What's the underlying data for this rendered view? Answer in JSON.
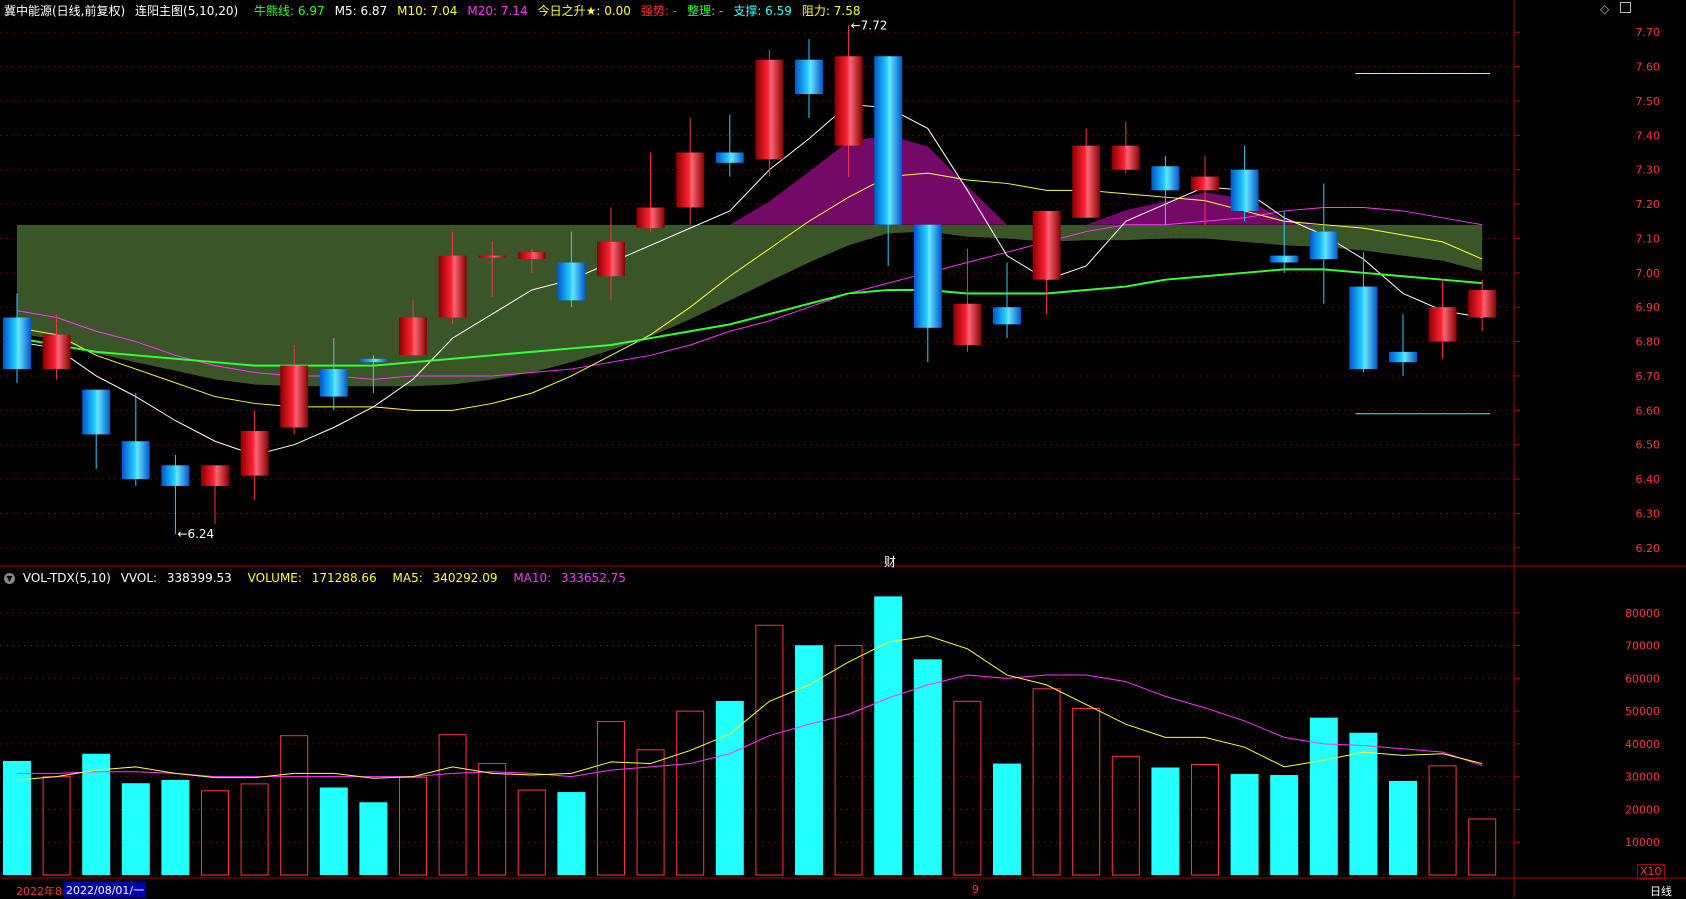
{
  "main_header": {
    "security": "冀中能源(日线,前复权)",
    "indicator": "连阳主图(5,10,20)",
    "items": [
      {
        "label": "牛熊线:",
        "value": "6.97",
        "color": "#33ff33"
      },
      {
        "label": "M5:",
        "value": "6.87",
        "color": "#ffffff"
      },
      {
        "label": "M10:",
        "value": "7.04",
        "color": "#ffff33"
      },
      {
        "label": "M20:",
        "value": "7.14",
        "color": "#ff33ff"
      },
      {
        "label": "今日之升★:",
        "value": "0.00",
        "color": "#ffff33"
      },
      {
        "label": "强势:",
        "value": "-",
        "color": "#ff3333"
      },
      {
        "label": "整理:",
        "value": "-",
        "color": "#33ff33"
      },
      {
        "label": "支撑:",
        "value": "6.59",
        "color": "#33ffff"
      },
      {
        "label": "阻力:",
        "value": "7.58",
        "color": "#ffff33"
      }
    ]
  },
  "vol_header": {
    "indicator": "VOL-TDX(5,10)",
    "vvol_label": "VVOL:",
    "vvol_value": "338399.53",
    "volume_label": "VOLUME:",
    "volume_value": "171288.66",
    "ma5_label": "MA5:",
    "ma5_value": "340292.09",
    "ma10_label": "MA10:",
    "ma10_value": "333652.75"
  },
  "annotations": {
    "high_label": "7.72",
    "low_label": "6.24",
    "fin_marker": "财",
    "vol_scale": "X10",
    "period": "日线",
    "date_left": "2022年8",
    "date_cursor": "2022/08/01/一",
    "date_mid": "9"
  },
  "colors": {
    "up": "#ff2233",
    "down": "#22ccff",
    "axis": "#aa0000",
    "grid": "#660000",
    "label": "#ff3333"
  },
  "chart_data": {
    "type": "candlestick",
    "price_axis": {
      "ylim": [
        6.15,
        7.75
      ],
      "ticks": [
        6.2,
        6.3,
        6.4,
        6.5,
        6.6,
        6.7,
        6.8,
        6.9,
        7.0,
        7.1,
        7.2,
        7.3,
        7.4,
        7.5,
        7.6,
        7.7
      ]
    },
    "candles": [
      {
        "o": 6.87,
        "h": 6.94,
        "l": 6.68,
        "c": 6.72
      },
      {
        "o": 6.72,
        "h": 6.88,
        "l": 6.69,
        "c": 6.82
      },
      {
        "o": 6.66,
        "h": 6.66,
        "l": 6.43,
        "c": 6.53
      },
      {
        "o": 6.51,
        "h": 6.65,
        "l": 6.38,
        "c": 6.4
      },
      {
        "o": 6.44,
        "h": 6.47,
        "l": 6.24,
        "c": 6.38
      },
      {
        "o": 6.38,
        "h": 6.44,
        "l": 6.27,
        "c": 6.44
      },
      {
        "o": 6.41,
        "h": 6.6,
        "l": 6.34,
        "c": 6.54
      },
      {
        "o": 6.55,
        "h": 6.79,
        "l": 6.53,
        "c": 6.73
      },
      {
        "o": 6.72,
        "h": 6.81,
        "l": 6.6,
        "c": 6.64
      },
      {
        "o": 6.75,
        "h": 6.76,
        "l": 6.65,
        "c": 6.74
      },
      {
        "o": 6.76,
        "h": 6.92,
        "l": 6.76,
        "c": 6.87
      },
      {
        "o": 6.87,
        "h": 7.12,
        "l": 6.85,
        "c": 7.05
      },
      {
        "o": 7.05,
        "h": 7.09,
        "l": 6.93,
        "c": 7.05
      },
      {
        "o": 7.04,
        "h": 7.07,
        "l": 7.0,
        "c": 7.06
      },
      {
        "o": 7.03,
        "h": 7.12,
        "l": 6.9,
        "c": 6.92
      },
      {
        "o": 6.99,
        "h": 7.19,
        "l": 6.92,
        "c": 7.09
      },
      {
        "o": 7.13,
        "h": 7.35,
        "l": 7.12,
        "c": 7.19
      },
      {
        "o": 7.19,
        "h": 7.45,
        "l": 7.14,
        "c": 7.35
      },
      {
        "o": 7.35,
        "h": 7.46,
        "l": 7.28,
        "c": 7.32
      },
      {
        "o": 7.33,
        "h": 7.65,
        "l": 7.28,
        "c": 7.62
      },
      {
        "o": 7.62,
        "h": 7.68,
        "l": 7.45,
        "c": 7.52
      },
      {
        "o": 7.37,
        "h": 7.72,
        "l": 7.28,
        "c": 7.63
      },
      {
        "o": 7.63,
        "h": 7.63,
        "l": 7.02,
        "c": 7.14
      },
      {
        "o": 7.14,
        "h": 7.14,
        "l": 6.74,
        "c": 6.84
      },
      {
        "o": 6.79,
        "h": 7.07,
        "l": 6.77,
        "c": 6.91
      },
      {
        "o": 6.9,
        "h": 7.03,
        "l": 6.81,
        "c": 6.85
      },
      {
        "o": 6.98,
        "h": 7.18,
        "l": 6.88,
        "c": 7.18
      },
      {
        "o": 7.16,
        "h": 7.42,
        "l": 7.16,
        "c": 7.37
      },
      {
        "o": 7.3,
        "h": 7.44,
        "l": 7.29,
        "c": 7.37
      },
      {
        "o": 7.31,
        "h": 7.34,
        "l": 7.14,
        "c": 7.24
      },
      {
        "o": 7.24,
        "h": 7.34,
        "l": 7.14,
        "c": 7.28
      },
      {
        "o": 7.3,
        "h": 7.37,
        "l": 7.15,
        "c": 7.18
      },
      {
        "o": 7.05,
        "h": 7.18,
        "l": 7.0,
        "c": 7.03
      },
      {
        "o": 7.12,
        "h": 7.26,
        "l": 6.91,
        "c": 7.04
      },
      {
        "o": 6.96,
        "h": 7.06,
        "l": 6.71,
        "c": 6.72
      },
      {
        "o": 6.77,
        "h": 6.88,
        "l": 6.7,
        "c": 6.74
      },
      {
        "o": 6.8,
        "h": 6.98,
        "l": 6.75,
        "c": 6.9
      },
      {
        "o": 6.87,
        "h": 6.98,
        "l": 6.83,
        "c": 6.95
      }
    ],
    "ma5": [
      6.8,
      6.78,
      6.7,
      6.64,
      6.57,
      6.51,
      6.47,
      6.5,
      6.55,
      6.61,
      6.69,
      6.81,
      6.88,
      6.95,
      6.98,
      7.03,
      7.08,
      7.13,
      7.18,
      7.3,
      7.39,
      7.49,
      7.48,
      7.42,
      7.24,
      7.05,
      6.98,
      7.02,
      7.15,
      7.2,
      7.25,
      7.24,
      7.16,
      7.11,
      7.04,
      6.94,
      6.89,
      6.87
    ],
    "ma10": [
      6.84,
      6.82,
      6.76,
      6.72,
      6.68,
      6.64,
      6.62,
      6.61,
      6.61,
      6.61,
      6.6,
      6.6,
      6.62,
      6.65,
      6.7,
      6.76,
      6.82,
      6.9,
      6.99,
      7.07,
      7.15,
      7.22,
      7.28,
      7.29,
      7.27,
      7.26,
      7.24,
      7.24,
      7.23,
      7.22,
      7.21,
      7.18,
      7.15,
      7.14,
      7.13,
      7.11,
      7.09,
      7.04
    ],
    "ma20": [
      6.89,
      6.87,
      6.83,
      6.8,
      6.76,
      6.73,
      6.71,
      6.7,
      6.7,
      6.69,
      6.7,
      6.7,
      6.7,
      6.71,
      6.72,
      6.74,
      6.76,
      6.79,
      6.83,
      6.86,
      6.9,
      6.94,
      6.97,
      7.0,
      7.03,
      7.06,
      7.09,
      7.12,
      7.14,
      7.14,
      7.15,
      7.16,
      7.18,
      7.19,
      7.19,
      7.18,
      7.16,
      7.14
    ],
    "bull_bear_line": [
      6.81,
      6.79,
      6.77,
      6.76,
      6.75,
      6.74,
      6.73,
      6.73,
      6.73,
      6.73,
      6.74,
      6.75,
      6.76,
      6.77,
      6.78,
      6.79,
      6.81,
      6.83,
      6.85,
      6.88,
      6.91,
      6.94,
      6.95,
      6.95,
      6.94,
      6.94,
      6.94,
      6.95,
      6.96,
      6.98,
      6.99,
      7.0,
      7.01,
      7.01,
      7.0,
      6.99,
      6.98,
      6.97
    ],
    "support": 6.59,
    "resistance": 7.58,
    "volume_axis": {
      "ylim": [
        0,
        90000
      ],
      "ticks": [
        10000,
        20000,
        30000,
        40000,
        50000,
        60000,
        70000,
        80000
      ]
    },
    "volume": [
      34800,
      30000,
      37000,
      28000,
      29000,
      25700,
      27800,
      42500,
      26700,
      22200,
      29800,
      42800,
      34000,
      25900,
      25300,
      46800,
      38200,
      50000,
      53100,
      76200,
      70100,
      70000,
      85000,
      65800,
      53000,
      34000,
      56800,
      50800,
      36200,
      32800,
      33700,
      30800,
      30500,
      48000,
      43400,
      28700,
      33300,
      17100
    ],
    "vol_ma5": [
      29000,
      30000,
      32000,
      33000,
      31000,
      29700,
      29700,
      31000,
      31000,
      29500,
      30000,
      33000,
      31000,
      30500,
      31000,
      34500,
      34000,
      38000,
      43000,
      53000,
      58000,
      65000,
      71000,
      73000,
      69000,
      61000,
      58000,
      52000,
      46000,
      42000,
      42000,
      39000,
      33000,
      35000,
      37500,
      36500,
      37000,
      34000
    ],
    "vol_ma10": [
      31000,
      31000,
      31500,
      31500,
      31000,
      30000,
      30000,
      30000,
      30000,
      30000,
      30000,
      31000,
      31500,
      31000,
      30000,
      32000,
      33000,
      34000,
      37000,
      42500,
      46000,
      49000,
      54000,
      58000,
      61000,
      60000,
      61000,
      61000,
      59000,
      54500,
      51000,
      47000,
      42000,
      40000,
      39500,
      38500,
      37500,
      33400
    ]
  }
}
